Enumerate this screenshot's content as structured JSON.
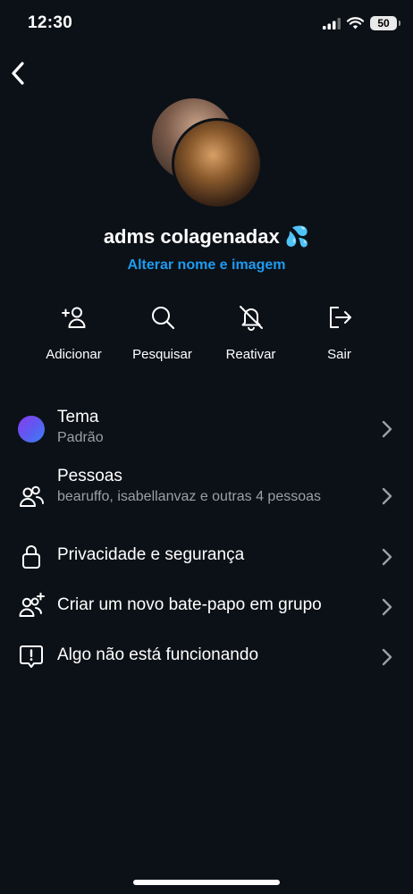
{
  "status_bar": {
    "time": "12:30",
    "battery": "50"
  },
  "header": {
    "back_icon": "chevron-left-icon"
  },
  "group": {
    "name": "adms colagenadax 💦",
    "edit_link": "Alterar nome e imagem"
  },
  "actions": [
    {
      "label": "Adicionar",
      "icon": "add-person-icon"
    },
    {
      "label": "Pesquisar",
      "icon": "search-icon"
    },
    {
      "label": "Reativar",
      "icon": "bell-off-icon"
    },
    {
      "label": "Sair",
      "icon": "logout-icon"
    }
  ],
  "menu": [
    {
      "title": "Tema",
      "subtitle": "Padrão",
      "icon": "theme-color-icon"
    },
    {
      "title": "Pessoas",
      "subtitle": "bearuffo, isabellanvaz e outras 4 pessoas",
      "icon": "people-icon"
    },
    {
      "title": "Privacidade e segurança",
      "subtitle": "",
      "icon": "lock-icon"
    },
    {
      "title": "Criar um novo bate-papo em grupo",
      "subtitle": "",
      "icon": "group-add-icon"
    },
    {
      "title": "Algo não está funcionando",
      "subtitle": "",
      "icon": "report-icon"
    }
  ],
  "colors": {
    "background": "#0c1117",
    "link": "#1d9bf0",
    "secondary_text": "#9aa0a8"
  }
}
